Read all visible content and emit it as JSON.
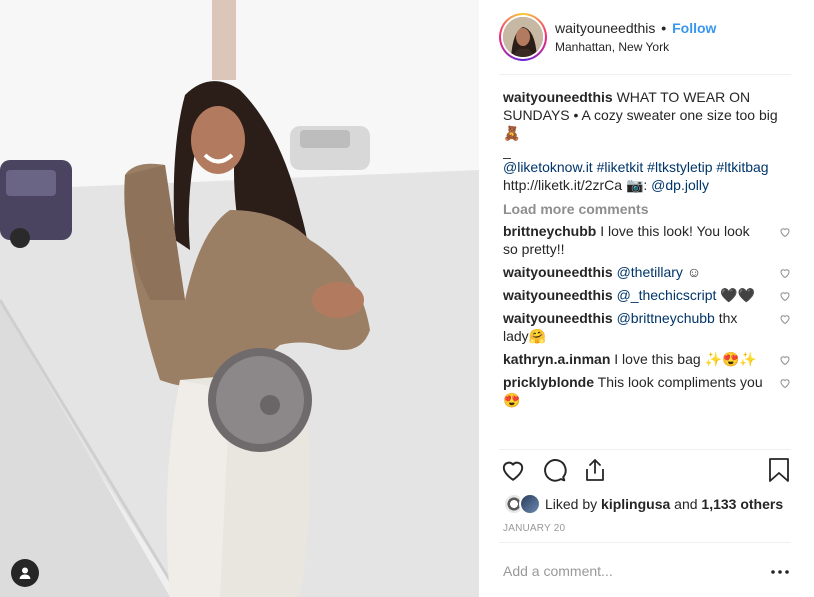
{
  "post": {
    "username": "waityouneedthis",
    "separator": "•",
    "follow_label": "Follow",
    "location": "Manhattan, New York"
  },
  "caption": {
    "username": "waityouneedthis",
    "text": "WHAT TO WEAR ON SUNDAYS • A cozy sweater one size too big 🧸",
    "dash": "_",
    "tags": [
      "@liketoknow.it",
      "#liketkit",
      "#ltkstyletip",
      "#ltkitbag"
    ],
    "url": "http://liketk.it/2zrCa",
    "camera": "📷:",
    "credit": "@dp.jolly"
  },
  "load_more_label": "Load more comments",
  "comments": [
    {
      "user": "brittneychubb",
      "mention": "",
      "text": "I love this look! You look so pretty!!"
    },
    {
      "user": "waityouneedthis",
      "mention": "@thetillary",
      "text": "☺"
    },
    {
      "user": "waityouneedthis",
      "mention": "@_thechicscript",
      "text": "🖤🖤"
    },
    {
      "user": "waityouneedthis",
      "mention": "@brittneychubb",
      "text": "thx lady🤗"
    },
    {
      "user": "kathryn.a.inman",
      "mention": "",
      "text": "I love this bag ✨😍✨"
    },
    {
      "user": "pricklyblonde",
      "mention": "",
      "text": "This look compliments you 😍"
    }
  ],
  "actions": {
    "like_icon": "heart-icon",
    "comment_icon": "comment-bubble-icon",
    "share_icon": "share-icon",
    "save_icon": "bookmark-icon"
  },
  "likes": {
    "prefix": "Liked by",
    "user": "kiplingusa",
    "middle": "and",
    "count_text": "1,133 others"
  },
  "date": "JANUARY 20",
  "add_comment_placeholder": "Add a comment...",
  "more_label": "•••",
  "colors": {
    "link": "#003569",
    "follow": "#3897f0",
    "muted": "#8e8e8e",
    "text": "#262626"
  }
}
